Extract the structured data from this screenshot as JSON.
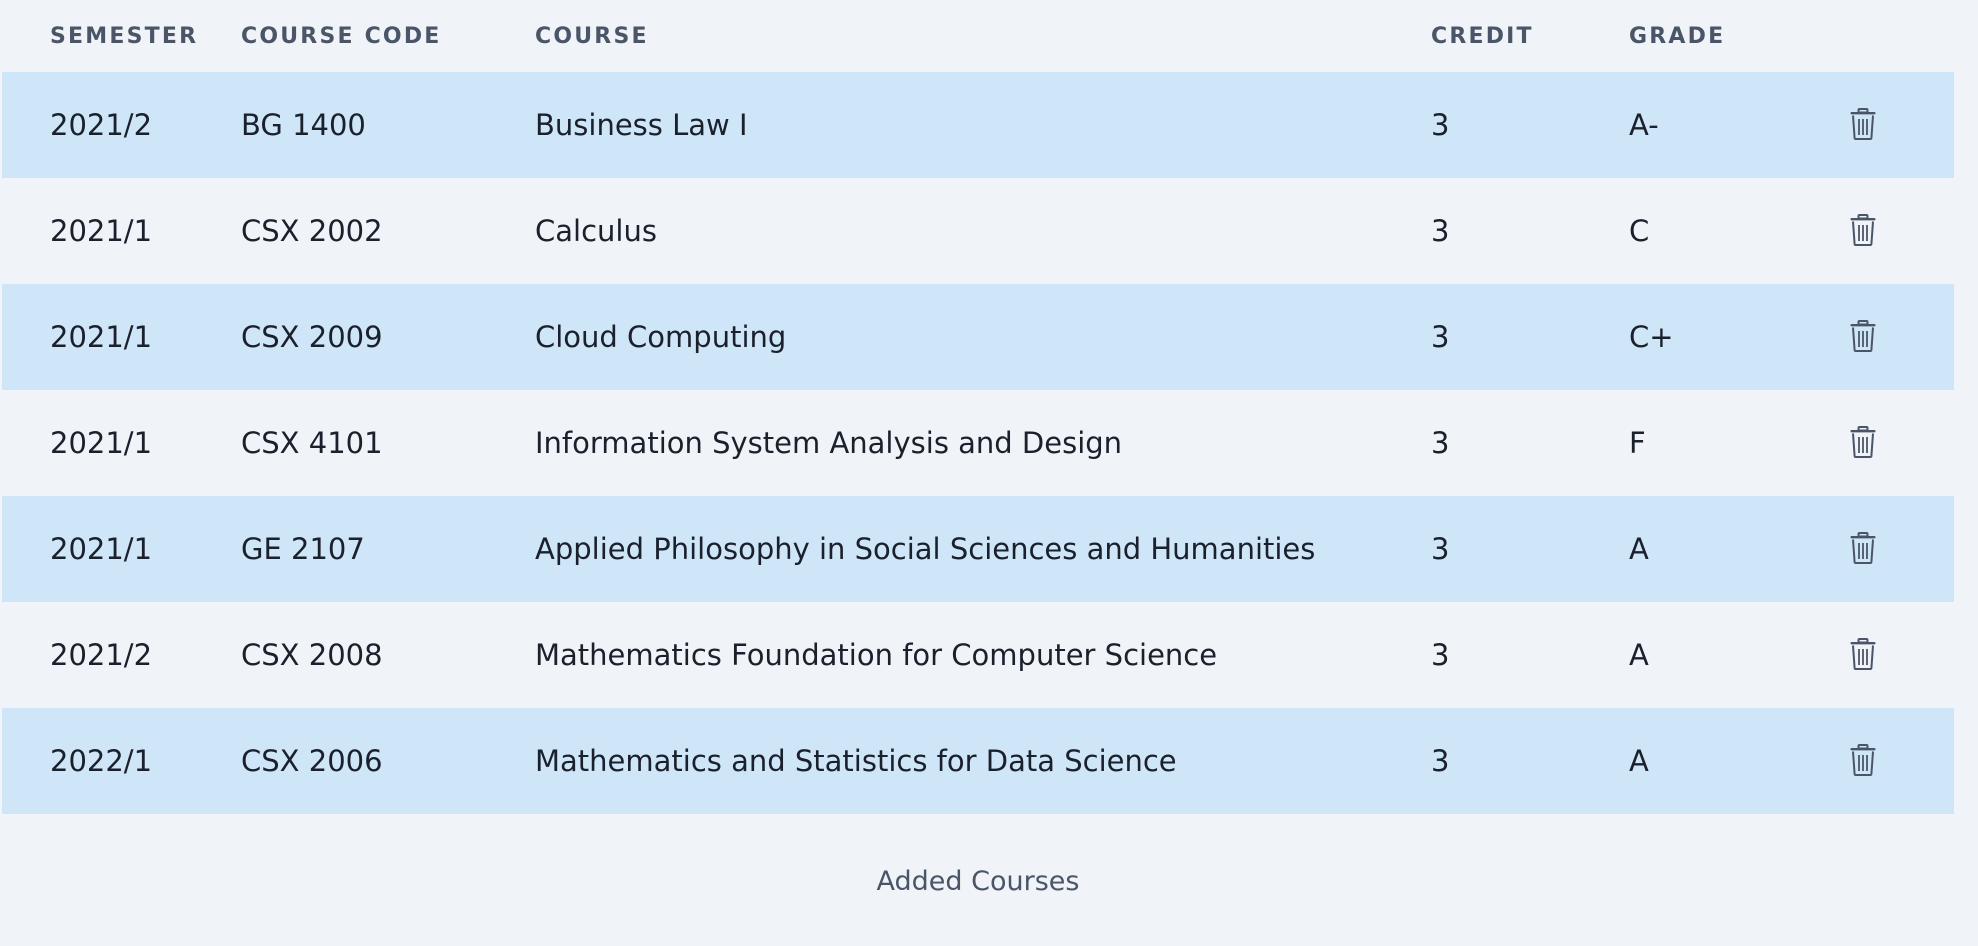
{
  "table": {
    "headers": {
      "semester": "SEMESTER",
      "course_code": "COURSE CODE",
      "course": "COURSE",
      "credit": "CREDIT",
      "grade": "GRADE"
    },
    "rows": [
      {
        "semester": "2021/2",
        "course_code": "BG 1400",
        "course": "Business Law I",
        "credit": "3",
        "grade": "A-"
      },
      {
        "semester": "2021/1",
        "course_code": "CSX 2002",
        "course": "Calculus",
        "credit": "3",
        "grade": "C"
      },
      {
        "semester": "2021/1",
        "course_code": "CSX 2009",
        "course": "Cloud Computing",
        "credit": "3",
        "grade": "C+"
      },
      {
        "semester": "2021/1",
        "course_code": "CSX 4101",
        "course": "Information System Analysis and Design",
        "credit": "3",
        "grade": "F"
      },
      {
        "semester": "2021/1",
        "course_code": "GE 2107",
        "course": "Applied Philosophy in Social Sciences and Humanities",
        "credit": "3",
        "grade": "A"
      },
      {
        "semester": "2021/2",
        "course_code": "CSX 2008",
        "course": "Mathematics Foundation for Computer Science",
        "credit": "3",
        "grade": "A"
      },
      {
        "semester": "2022/1",
        "course_code": "CSX 2006",
        "course": "Mathematics and Statistics for Data Science",
        "credit": "3",
        "grade": "A"
      }
    ],
    "row_action_icon": "trash-icon"
  },
  "footer": {
    "caption": "Added Courses"
  },
  "colors": {
    "page_background": "#f0f4f8",
    "striped_row": "#cfe6f9",
    "header_text": "#4a5568",
    "body_text": "#1a202c"
  }
}
